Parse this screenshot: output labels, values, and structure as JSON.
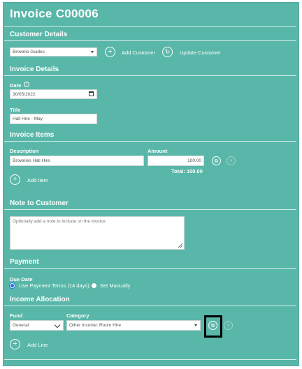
{
  "invoice": {
    "title": "Invoice C00006"
  },
  "customer": {
    "section": "Customer Details",
    "selected": "Brownie Guides",
    "add_label": "Add Customer",
    "update_label": "Update Customer"
  },
  "details": {
    "section": "Invoice Details",
    "date_label": "Date",
    "date_value": "30/05/2022",
    "title_label": "Title",
    "title_value": "Hall Hire - May"
  },
  "items": {
    "section": "Invoice Items",
    "col_description": "Description",
    "col_amount": "Amount",
    "rows": [
      {
        "description": "Brownies Hall Hire",
        "amount": "100.00"
      }
    ],
    "total": "Total: 100.00",
    "add_label": "Add Item"
  },
  "note": {
    "section": "Note to Customer",
    "placeholder": "Optionally add a note to include on the invoice"
  },
  "payment": {
    "section": "Payment",
    "due_label": "Due Date",
    "option_terms": "Use Payment Terms (14 days)",
    "option_manual": "Set Manually",
    "selected": "terms"
  },
  "income": {
    "section": "Income Allocation",
    "fund_label": "Fund",
    "category_label": "Category",
    "fund_value": "General",
    "category_value": "Other Income: Room Hire",
    "add_label": "Add Line"
  },
  "icons": {
    "info": "info-icon",
    "add": "plus-circle-icon",
    "refresh": "refresh-circle-icon",
    "copy": "copy-icon",
    "remove": "close-icon",
    "calendar": "calendar-icon"
  },
  "colors": {
    "background": "#58b7a8",
    "field": "#ffffff",
    "selected_radio": "#1a73e8"
  }
}
